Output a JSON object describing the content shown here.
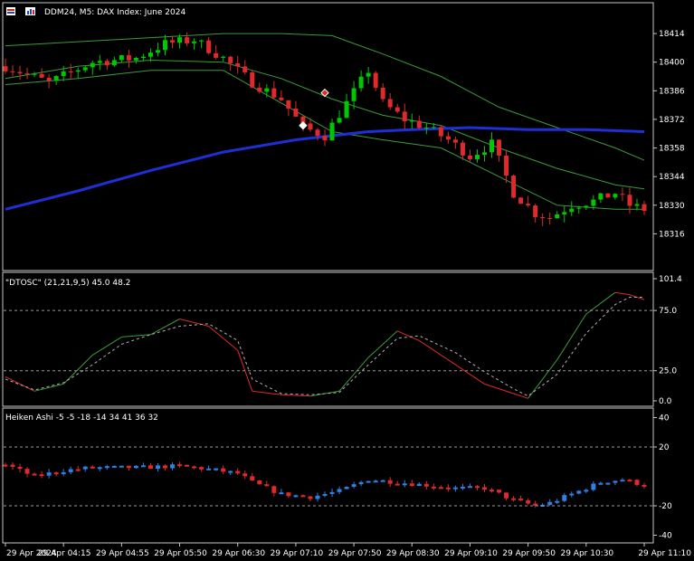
{
  "chart_header": {
    "title": "DDM24, M5:  DAX Index: June 2024",
    "icon": "chart-window-icons"
  },
  "panels": {
    "oscillator_label": "\"DTOSC\" (21,21,9,5) 45.0 48.2",
    "heiken_label": "Heiken Ashi -5 -5 -18 -14 34 41 36 32"
  },
  "colors": {
    "background": "#000000",
    "bull": "#00c800",
    "bear": "#e0292b",
    "ha_bull": "#2f7fe6",
    "ha_bear": "#e0292b",
    "band": "#3c9a3c",
    "ma_long": "#1f2fd6",
    "osc_fast_up": "#3c9a3c",
    "osc_fast_down": "#e0292b",
    "osc_slow": "#b0b0b0",
    "grid_text": "#ffffff",
    "border": "#c8c8c8"
  },
  "chart_data": [
    {
      "type": "candlestick",
      "name": "price",
      "y_ticks": [
        18414,
        18400,
        18386,
        18372,
        18358,
        18344,
        18330,
        18316
      ],
      "ylim": [
        18302,
        18426
      ],
      "anchors": [
        [
          0,
          18398
        ],
        [
          6,
          18390
        ],
        [
          12,
          18400
        ],
        [
          18,
          18402
        ],
        [
          22,
          18409
        ],
        [
          26,
          18411
        ],
        [
          30,
          18402
        ],
        [
          34,
          18390
        ],
        [
          38,
          18382
        ],
        [
          41,
          18368
        ],
        [
          44,
          18364
        ],
        [
          47,
          18380
        ],
        [
          50,
          18396
        ],
        [
          52,
          18380
        ],
        [
          55,
          18372
        ],
        [
          58,
          18368
        ],
        [
          61,
          18362
        ],
        [
          64,
          18354
        ],
        [
          67,
          18360
        ],
        [
          70,
          18336
        ],
        [
          73,
          18326
        ],
        [
          75,
          18324
        ],
        [
          78,
          18330
        ],
        [
          81,
          18332
        ],
        [
          84,
          18336
        ],
        [
          86,
          18330
        ],
        [
          88,
          18328
        ]
      ],
      "markers": [
        {
          "at": 41,
          "price": 18369,
          "color": "#ffffff"
        },
        {
          "at": 44,
          "price": 18385,
          "color": "#e0292b"
        }
      ],
      "bands": {
        "upper": [
          [
            0,
            18408
          ],
          [
            10,
            18410
          ],
          [
            20,
            18412
          ],
          [
            30,
            18414
          ],
          [
            38,
            18414
          ],
          [
            45,
            18413
          ],
          [
            52,
            18404
          ],
          [
            60,
            18393
          ],
          [
            68,
            18378
          ],
          [
            76,
            18368
          ],
          [
            84,
            18358
          ],
          [
            88,
            18352
          ]
        ],
        "mid": [
          [
            0,
            18392
          ],
          [
            10,
            18398
          ],
          [
            20,
            18401
          ],
          [
            30,
            18400
          ],
          [
            38,
            18392
          ],
          [
            45,
            18382
          ],
          [
            52,
            18374
          ],
          [
            60,
            18369
          ],
          [
            68,
            18358
          ],
          [
            76,
            18348
          ],
          [
            84,
            18340
          ],
          [
            88,
            18338
          ]
        ],
        "lower": [
          [
            0,
            18389
          ],
          [
            10,
            18392
          ],
          [
            20,
            18396
          ],
          [
            30,
            18396
          ],
          [
            38,
            18380
          ],
          [
            45,
            18366
          ],
          [
            52,
            18362
          ],
          [
            60,
            18358
          ],
          [
            68,
            18344
          ],
          [
            76,
            18330
          ],
          [
            84,
            18328
          ],
          [
            88,
            18328
          ]
        ]
      },
      "ma_long": [
        [
          0,
          18328
        ],
        [
          10,
          18337
        ],
        [
          20,
          18347
        ],
        [
          30,
          18356
        ],
        [
          40,
          18362
        ],
        [
          50,
          18366
        ],
        [
          56,
          18367
        ],
        [
          64,
          18368
        ],
        [
          72,
          18367
        ],
        [
          80,
          18367
        ],
        [
          88,
          18366
        ]
      ]
    },
    {
      "type": "line",
      "name": "DTOSC",
      "y_ticks": [
        101.4,
        75.0,
        25.0,
        0.0
      ],
      "ylim": [
        0,
        101.4
      ],
      "levels": [
        75.0,
        25.0
      ],
      "fast": [
        [
          0,
          20
        ],
        [
          4,
          8
        ],
        [
          8,
          14
        ],
        [
          12,
          38
        ],
        [
          16,
          53
        ],
        [
          20,
          55
        ],
        [
          24,
          68
        ],
        [
          28,
          62
        ],
        [
          32,
          42
        ],
        [
          34,
          8
        ],
        [
          38,
          5
        ],
        [
          42,
          4
        ],
        [
          46,
          8
        ],
        [
          50,
          36
        ],
        [
          54,
          58
        ],
        [
          57,
          50
        ],
        [
          62,
          30
        ],
        [
          66,
          14
        ],
        [
          70,
          6
        ],
        [
          72,
          2
        ],
        [
          76,
          34
        ],
        [
          80,
          72
        ],
        [
          84,
          90
        ],
        [
          86,
          88
        ],
        [
          88,
          84
        ]
      ],
      "slow": [
        [
          0,
          18
        ],
        [
          4,
          9
        ],
        [
          8,
          15
        ],
        [
          12,
          30
        ],
        [
          16,
          47
        ],
        [
          20,
          55
        ],
        [
          24,
          62
        ],
        [
          28,
          64
        ],
        [
          32,
          50
        ],
        [
          34,
          18
        ],
        [
          38,
          6
        ],
        [
          42,
          5
        ],
        [
          46,
          7
        ],
        [
          50,
          30
        ],
        [
          54,
          52
        ],
        [
          57,
          54
        ],
        [
          62,
          40
        ],
        [
          66,
          24
        ],
        [
          70,
          10
        ],
        [
          72,
          4
        ],
        [
          76,
          22
        ],
        [
          80,
          56
        ],
        [
          84,
          80
        ],
        [
          86,
          86
        ],
        [
          88,
          86
        ]
      ]
    },
    {
      "type": "bar",
      "name": "Heiken Ashi",
      "y_ticks": [
        40,
        20,
        -20,
        -40
      ],
      "ylim": [
        -44,
        44
      ],
      "levels": [
        20,
        -20
      ],
      "anchors": [
        [
          0,
          8
        ],
        [
          4,
          0
        ],
        [
          8,
          4
        ],
        [
          12,
          6
        ],
        [
          18,
          6
        ],
        [
          24,
          7
        ],
        [
          28,
          5
        ],
        [
          32,
          2
        ],
        [
          34,
          -4
        ],
        [
          38,
          -12
        ],
        [
          42,
          -14
        ],
        [
          46,
          -10
        ],
        [
          50,
          -2
        ],
        [
          54,
          -4
        ],
        [
          58,
          -6
        ],
        [
          62,
          -8
        ],
        [
          66,
          -8
        ],
        [
          70,
          -16
        ],
        [
          73,
          -20
        ],
        [
          75,
          -18
        ],
        [
          78,
          -12
        ],
        [
          82,
          -4
        ],
        [
          85,
          -2
        ],
        [
          88,
          -6
        ]
      ]
    }
  ],
  "time_axis": {
    "labels": [
      "29 Apr 2024",
      "29 Apr 04:15",
      "29 Apr 04:55",
      "29 Apr 05:50",
      "29 Apr 06:30",
      "29 Apr 07:10",
      "29 Apr 07:50",
      "29 Apr 08:30",
      "29 Apr 09:10",
      "29 Apr 09:50",
      "29 Apr 10:30",
      "29 Apr 11:10"
    ],
    "label_bars": [
      0,
      8,
      16,
      24,
      32,
      40,
      48,
      56,
      64,
      72,
      80,
      88
    ]
  }
}
